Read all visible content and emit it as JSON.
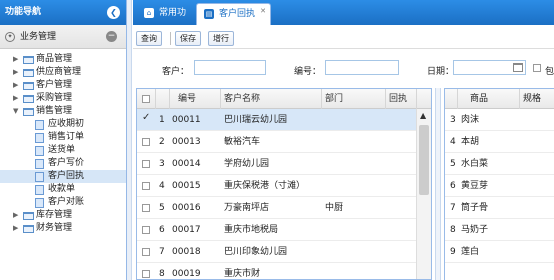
{
  "sidebar": {
    "title": "功能导航",
    "group_label": "业务管理",
    "items": [
      {
        "label": "商品管理",
        "type": "folder"
      },
      {
        "label": "供应商管理",
        "type": "folder"
      },
      {
        "label": "客户管理",
        "type": "folder"
      },
      {
        "label": "采购管理",
        "type": "folder"
      },
      {
        "label": "销售管理",
        "type": "folder-open"
      },
      {
        "label": "应收期初",
        "type": "page"
      },
      {
        "label": "销售订单",
        "type": "page"
      },
      {
        "label": "送货单",
        "type": "page"
      },
      {
        "label": "客户写价",
        "type": "page"
      },
      {
        "label": "客户回执",
        "type": "page",
        "selected": true
      },
      {
        "label": "收款单",
        "type": "page"
      },
      {
        "label": "客户对账",
        "type": "page"
      },
      {
        "label": "库存管理",
        "type": "folder"
      },
      {
        "label": "财务管理",
        "type": "folder"
      }
    ]
  },
  "tabs": [
    {
      "label": "常用功能",
      "icon": "home-icon"
    },
    {
      "label": "客户回执",
      "icon": "page-icon",
      "active": true
    }
  ],
  "toolbar": {
    "query_label": "查询",
    "save_label": "保存",
    "add_label": "增行"
  },
  "filter": {
    "customer_label": "客户：",
    "customer_value": "",
    "number_label": "编号：",
    "number_value": "",
    "date_label": "日期：",
    "date_value": "",
    "include_label": "包"
  },
  "grid": {
    "headers": {
      "code": "编号",
      "name": "客户名称",
      "dept": "部门",
      "back": "回执"
    },
    "rows": [
      {
        "num": "1",
        "code": "00011",
        "name": "巴川瑞云幼儿园",
        "dept": "",
        "checked": true
      },
      {
        "num": "2",
        "code": "00013",
        "name": "敏裕汽车",
        "dept": ""
      },
      {
        "num": "3",
        "code": "00014",
        "name": "学府幼儿园",
        "dept": ""
      },
      {
        "num": "4",
        "code": "00015",
        "name": "重庆保税港（寸滩）",
        "dept": ""
      },
      {
        "num": "5",
        "code": "00016",
        "name": "万豪南坪店",
        "dept": "中厨"
      },
      {
        "num": "6",
        "code": "00017",
        "name": "重庆市地税局",
        "dept": ""
      },
      {
        "num": "7",
        "code": "00018",
        "name": "巴川印象幼儿园",
        "dept": ""
      },
      {
        "num": "8",
        "code": "00019",
        "name": "重庆市财",
        "dept": ""
      }
    ]
  },
  "grid2": {
    "headers": {
      "product": "商品",
      "spec": "规格"
    },
    "rows": [
      {
        "num": "3",
        "product": "肉沫"
      },
      {
        "num": "4",
        "product": "本胡"
      },
      {
        "num": "5",
        "product": "水白菜"
      },
      {
        "num": "6",
        "product": "黄豆芽"
      },
      {
        "num": "7",
        "product": "筒子骨"
      },
      {
        "num": "8",
        "product": "马奶子"
      },
      {
        "num": "9",
        "product": "莲白"
      }
    ]
  },
  "colors": {
    "header_blue": "#1b6fc4",
    "selected_row": "#d7e7f8",
    "border": "#99bbe8"
  }
}
